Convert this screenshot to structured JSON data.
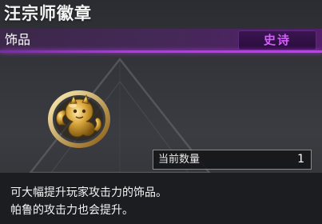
{
  "item": {
    "name": "汪宗师徽章",
    "category": "饰品",
    "rarity": "史诗"
  },
  "count": {
    "label": "当前数量",
    "value": "1"
  },
  "description": {
    "line1": "可大幅提升玩家攻击力的饰品。",
    "line2": "帕鲁的攻击力也会提升。"
  },
  "colors": {
    "rarity_text": "#d65cff",
    "rarity_bar": "#b03ae0",
    "badge_gold": "#d9a63a"
  },
  "icons": {
    "badge": "gold-cat-emblem-icon",
    "background": "triangle-watermark-icon"
  }
}
